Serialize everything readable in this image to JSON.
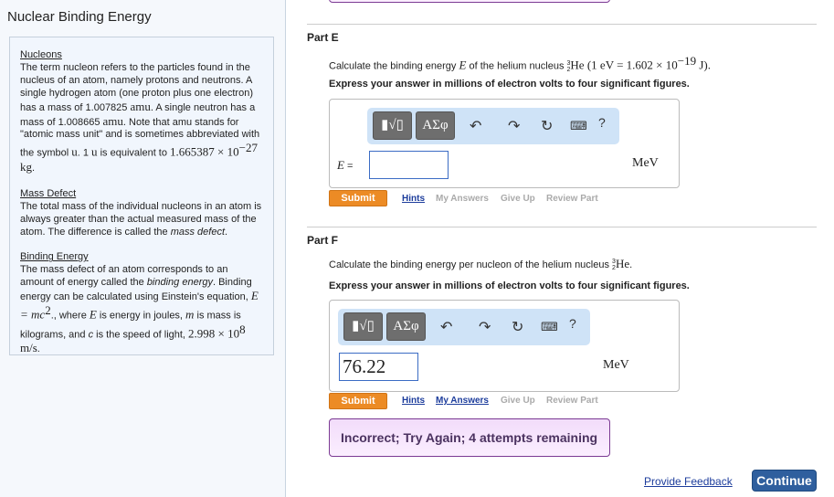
{
  "left": {
    "title": "Nuclear Binding Energy",
    "sections": [
      {
        "heading": "Nucleons",
        "text1": "The term nucleon refers to the particles found in the nucleus of an atom, namely protons and neutrons. A single hydrogen atom (one proton plus one electron) has a mass of 1.007825 ",
        "u1": "amu",
        "text2": ". A single neutron has a mass of 1.008665 ",
        "u2": "amu",
        "text3": ". Note that amu stands for \"atomic mass unit\" and is sometimes abbreviated with the symbol ",
        "u3": "u",
        "text4": ". 1 ",
        "u4": "u",
        "text5": " is equivalent to ",
        "val": "1.665387 × 10",
        "exp": "−27",
        "unit": " kg",
        "end": "."
      },
      {
        "heading": "Mass Defect",
        "text1": "The total mass of the individual nucleons in an atom is always greater than the actual measured mass of the atom. The difference is called the ",
        "em": "mass defect",
        "end": "."
      },
      {
        "heading": "Binding Energy",
        "text1": "The mass defect of an atom corresponds to an amount of energy called the ",
        "em": "binding energy",
        "text2": ". Binding energy can be calculated using Einstein's equation, ",
        "eq": "E = mc",
        "eqexp": "2",
        "text3": "., where ",
        "E": "E",
        "text4": " is energy in joules, ",
        "m": "m",
        "text5": " is mass is kilograms, and ",
        "c": "c",
        "text6": " is the speed of light, ",
        "speed": "2.998 × 10",
        "speedexp": "8",
        "speedunit": " m/s",
        "end": "."
      }
    ]
  },
  "partE": {
    "title": "Part E",
    "q1": "Calculate the binding energy ",
    "qE": "E",
    "q2": " of the helium nucleus ",
    "iso_a": "3",
    "iso_z": "2",
    "iso": "He",
    "q3": " (1 eV = 1.602 × 10",
    "q3exp": "−19",
    "q4": " J).",
    "express": "Express your answer in millions of electron volts to four significant figures.",
    "label": "E",
    "eq": " =",
    "value": "",
    "unit": "MeV"
  },
  "partF": {
    "title": "Part F",
    "q1": "Calculate the binding energy per nucleon of the helium nucleus ",
    "iso_a": "3",
    "iso_z": "2",
    "iso": "He",
    "q2": ".",
    "express": "Express your answer in millions of electron volts to four significant figures.",
    "value": "76.22",
    "unit": "MeV",
    "feedback": "Incorrect; Try Again; 4 attempts remaining"
  },
  "toolbar": {
    "greek": "ΑΣφ",
    "help": "?"
  },
  "actions": {
    "submit": "Submit",
    "hints": "Hints",
    "my_answers": "My Answers",
    "give_up": "Give Up",
    "review": "Review Part"
  },
  "footer": {
    "feedback": "Provide Feedback",
    "continue": "Continue"
  }
}
